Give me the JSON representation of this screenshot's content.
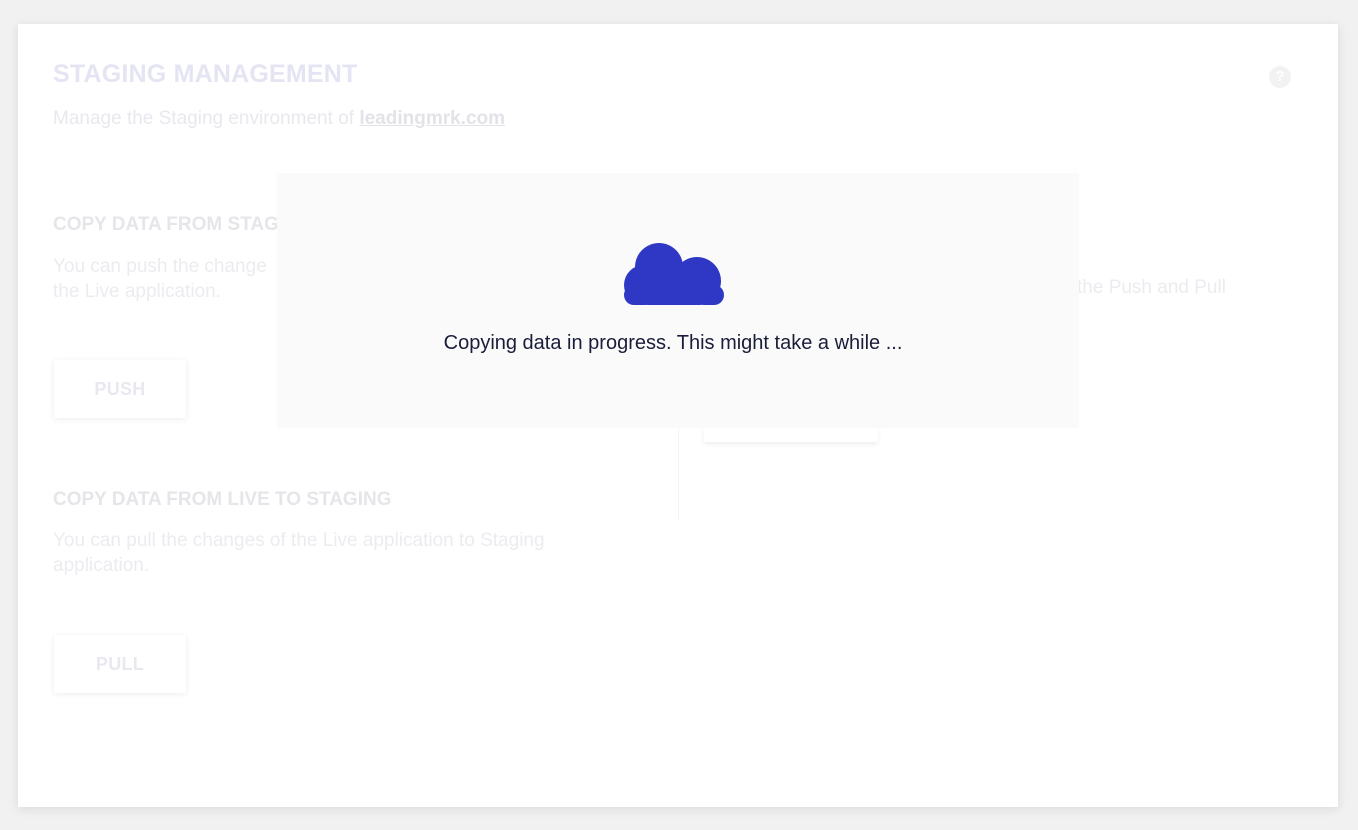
{
  "header": {
    "title": "STAGING MANAGEMENT",
    "subtitle_prefix": "Manage the Staging environment of ",
    "domain_link": "leadingmrk.com",
    "help_symbol": "?"
  },
  "sections": {
    "push": {
      "heading": "COPY DATA FROM STAG",
      "desc_line1": "You can push the change",
      "desc_line2": "the Live application.",
      "button_label": "PUSH"
    },
    "pull": {
      "heading": "COPY DATA FROM LIVE TO STAGING",
      "desc_line1": "You can pull the changes of the Live application to Staging",
      "desc_line2": "application.",
      "button_label": "PULL"
    },
    "right": {
      "desc_fragment": "the Push and Pull"
    }
  },
  "overlay": {
    "icon": "cloud-icon",
    "message": "Copying data in progress. This might take a while ..."
  },
  "colors": {
    "cloud": "#2f38c4",
    "message_text": "#1a1d3a"
  }
}
